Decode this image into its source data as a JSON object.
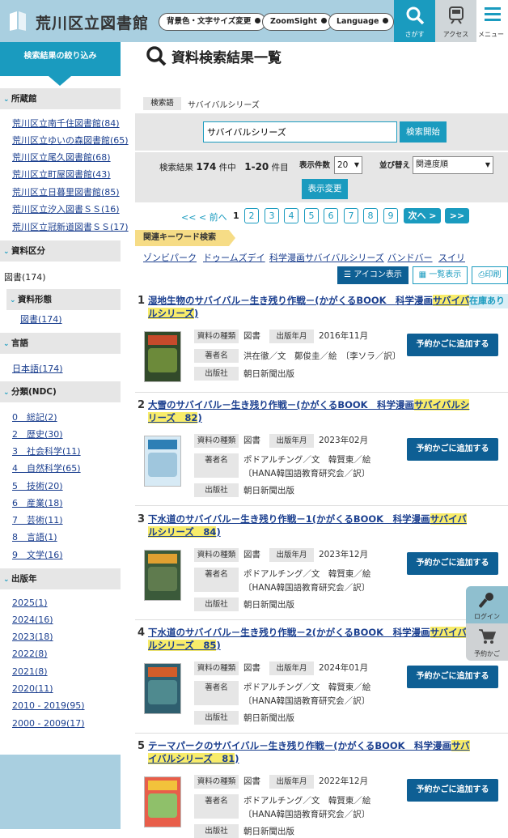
{
  "header": {
    "title": "荒川区立図書館",
    "btn_color": "背景色・文字サイズ変更",
    "btn_zoom": "ZoomSight",
    "btn_lang": "Language",
    "search_label": "さがす",
    "access_label": "アクセス",
    "menu_label": "メニュー"
  },
  "sidebar": {
    "heading": "検索結果の絞り込み",
    "sec_library": "所蔵館",
    "libraries": [
      "荒川区立南千住図書館(84)",
      "荒川区立ゆいの森図書館(65)",
      "荒川区立尾久図書館(68)",
      "荒川区立町屋図書館(43)",
      "荒川区立日暮里図書館(85)",
      "荒川区立汐入図書ＳＳ(16)",
      "荒川区立冠新道図書ＳＳ(17)"
    ],
    "sec_type": "資料区分",
    "type_value": "図書(174)",
    "sec_form": "資料形態",
    "form_value": "図書(174)",
    "sec_lang": "言語",
    "lang_value": "日本語(174)",
    "sec_ndc": "分類(NDC)",
    "ndc": [
      "0　総記(2)",
      "2　歴史(30)",
      "3　社会科学(11)",
      "4　自然科学(65)",
      "5　技術(20)",
      "6　産業(18)",
      "7　芸術(11)",
      "8　言語(1)",
      "9　文学(16)"
    ],
    "sec_year": "出版年",
    "years": [
      "2025(1)",
      "2024(16)",
      "2023(18)",
      "2022(8)",
      "2021(8)",
      "2020(11)",
      "2010 - 2019(95)",
      "2000 - 2009(17)"
    ]
  },
  "main": {
    "title": "資料検索結果一覧",
    "search_term_label": "検索語",
    "search_term": "サバイバルシリーズ",
    "search_input": "サバイバルシリーズ",
    "search_button": "検索開始",
    "result_prefix": "検索結果",
    "result_total": "174",
    "result_mid": "件中",
    "result_range": "1-20",
    "result_suffix": "件目",
    "per_page_label": "表示件数",
    "per_page": "20",
    "sort_label": "並び替え",
    "sort": "関連度順",
    "apply_button": "表示変更",
    "pager": {
      "first": "<<",
      "prev": "< 前へ",
      "current": "1",
      "pages": [
        "2",
        "3",
        "4",
        "5",
        "6",
        "7",
        "8",
        "9"
      ],
      "next": "次へ >",
      "last": ">>"
    },
    "related_label": "関連キーワード検索",
    "keywords": [
      "ゾンビパーク",
      "ドゥームズデイ",
      "科学漫画サバイバルシリーズ",
      "バンドバー",
      "スイリ"
    ],
    "view_icon": "アイコン表示",
    "view_list": "一覧表示",
    "print": "印刷",
    "lbl_type": "資料の種類",
    "lbl_date": "出版年月",
    "lbl_author": "著者名",
    "lbl_pub": "出版社",
    "reserve": "予約かごに追加する",
    "in_stock": "在庫あり",
    "results": [
      {
        "num": "1",
        "title_pre": "湿地生物のサバイバル－生き残り作戦－(かがくるBOOK　科学漫画",
        "title_hl1": "サバイバ",
        "title_hl2": "ルシリーズ",
        "title_post": ")",
        "type": "図書",
        "date": "2016年11月",
        "author1": "洪在徹／文　鄭俊圭／絵　〔李ソラ／訳〕",
        "author2": "",
        "publisher": "朝日新聞出版"
      },
      {
        "num": "2",
        "title_pre": "大雪のサバイバル－生き残り作戦－(かがくるBOOK　科学漫画",
        "title_hl1": "サバイバルシ",
        "title_hl2": "リーズ　82",
        "title_post": ")",
        "type": "図書",
        "date": "2023年02月",
        "author1": "ポドアルチング／文　韓賢東／絵",
        "author2": "〔HANA韓国語教育研究会／訳〕",
        "publisher": "朝日新聞出版"
      },
      {
        "num": "3",
        "title_pre": "下水道のサバイバル－生き残り作戦－1(かがくるBOOK　科学漫画",
        "title_hl1": "サバイバ",
        "title_hl2": "ルシリーズ　84",
        "title_post": ")",
        "type": "図書",
        "date": "2023年12月",
        "author1": "ポドアルチング／文　韓賢東／絵",
        "author2": "〔HANA韓国語教育研究会／訳〕",
        "publisher": "朝日新聞出版"
      },
      {
        "num": "4",
        "title_pre": "下水道のサバイバル－生き残り作戦－2(かがくるBOOK　科学漫画",
        "title_hl1": "サバイバ",
        "title_hl2": "ルシリーズ　85",
        "title_post": ")",
        "type": "図書",
        "date": "2024年01月",
        "author1": "ポドアルチング／文　韓賢東／絵",
        "author2": "〔HANA韓国語教育研究会／訳〕",
        "publisher": "朝日新聞出版"
      },
      {
        "num": "5",
        "title_pre": "テーマパークのサバイバル－生き残り作戦－(かがくるBOOK　科学漫画",
        "title_hl1": "サバ",
        "title_hl2": "イバルシリーズ　81",
        "title_post": ")",
        "type": "図書",
        "date": "2022年12月",
        "author1": "ポドアルチング／文　韓賢東／絵",
        "author2": "〔HANA韓国語教育研究会／訳〕",
        "publisher": "朝日新聞出版"
      }
    ]
  },
  "float": {
    "login": "ログイン",
    "cart": "予約かご"
  },
  "colors": {
    "accent": "#1a9bbf",
    "header": "#a9cfe0",
    "reserve_btn": "#0e5f94",
    "highlight": "#f8ec6a",
    "link": "#1b3f8f"
  }
}
